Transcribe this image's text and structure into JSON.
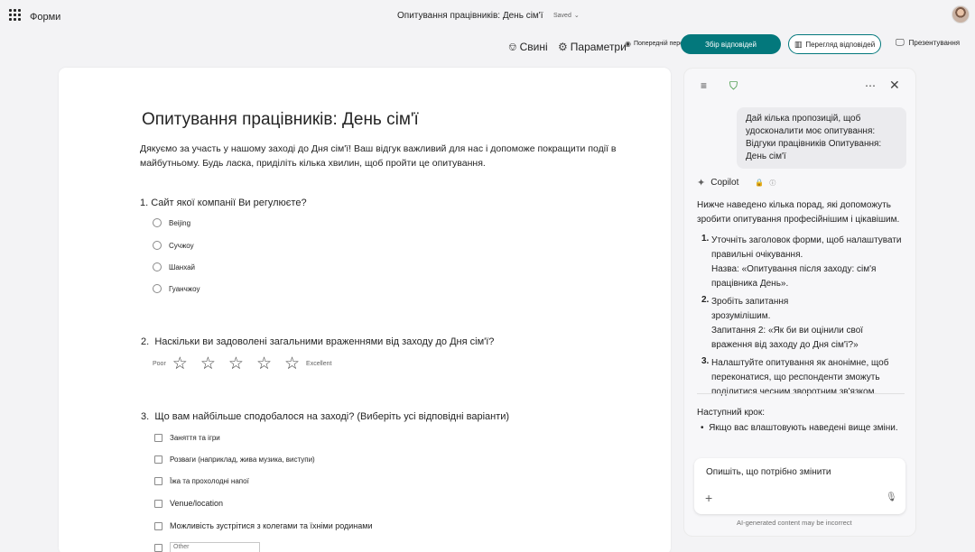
{
  "header": {
    "app_name": "Форми",
    "doc_title": "Опитування працівників: День сім'ї",
    "saved": "Saved",
    "saved_chevron": "⌄"
  },
  "toolbar": {
    "theme_label": "Свині",
    "settings_label": "Параметри",
    "preview_label": "Попередній перегляд",
    "collect_label": "Збір відповідей",
    "review_label": "Перегляд відповідей",
    "present_label": "Презентування"
  },
  "form": {
    "title": "Опитування працівників: День сім'ї",
    "description": "Дякуємо за участь у нашому заході до Дня сім'ї! Ваш відгук важливий для нас і допоможе покращити події в майбутньому. Будь ласка, приділіть кілька хвилин, щоб пройти це опитування.",
    "q1": {
      "title": "1. Сайт якої компанії Ви регулюєте?",
      "options": [
        "Beijing",
        "Сучжоу",
        "Шанхай",
        "Гуанчжоу"
      ]
    },
    "q2": {
      "number": "2.",
      "title": "Наскільки ви задоволені загальними враженнями від заходу до Дня сім'ї?",
      "low_label": "Poor",
      "high_label": "Excellent",
      "stars": 5
    },
    "q3": {
      "number": "3.",
      "title": "Що вам найбільше сподобалося на заході? (Виберіть усі відповідні варіанти)",
      "options": [
        "Заняття та ігри",
        "Розваги (наприклад, жива музика, виступи)",
        "Їжа та прохолодні напої",
        "Venue/location",
        "Можливість зустрітися з колегами та їхніми родинами"
      ],
      "other_placeholder": "Other"
    }
  },
  "copilot": {
    "user_message": "Дай кілька пропозицій, щоб удосконалити моє опитування: Відгуки працівників Опитування: День сім'ї",
    "name": "Copilot",
    "intro": "Нижче наведено кілька порад, які допоможуть зробити опитування професійнішим і цікавішим.",
    "tip1_num": "1.",
    "tip1_a": "Уточніть заголовок форми, щоб налаштувати правильні очікування.",
    "tip1_b": "Назва: «Опитування після заходу: сім'я працівника День».",
    "tip2_num": "2.",
    "tip2_a": "Зробіть запитання зрозумілішим.",
    "tip2_b": "Запитання 2: «Як би ви оцінили свої враження від заходу до Дня сім'ї?»",
    "tip3_num": "3.",
    "tip3_a": "Налаштуйте опитування як анонімне, щоб переконатися, що респонденти зможуть поділитися чесним зворотним зв'язком.",
    "next_step": "Наступний крок:",
    "bullet": "Якщо вас влаштовують наведені вище зміни.",
    "composer_placeholder": "Опишіть, що потрібно змінити",
    "disclaimer": "AI-generated content may be incorrect"
  }
}
